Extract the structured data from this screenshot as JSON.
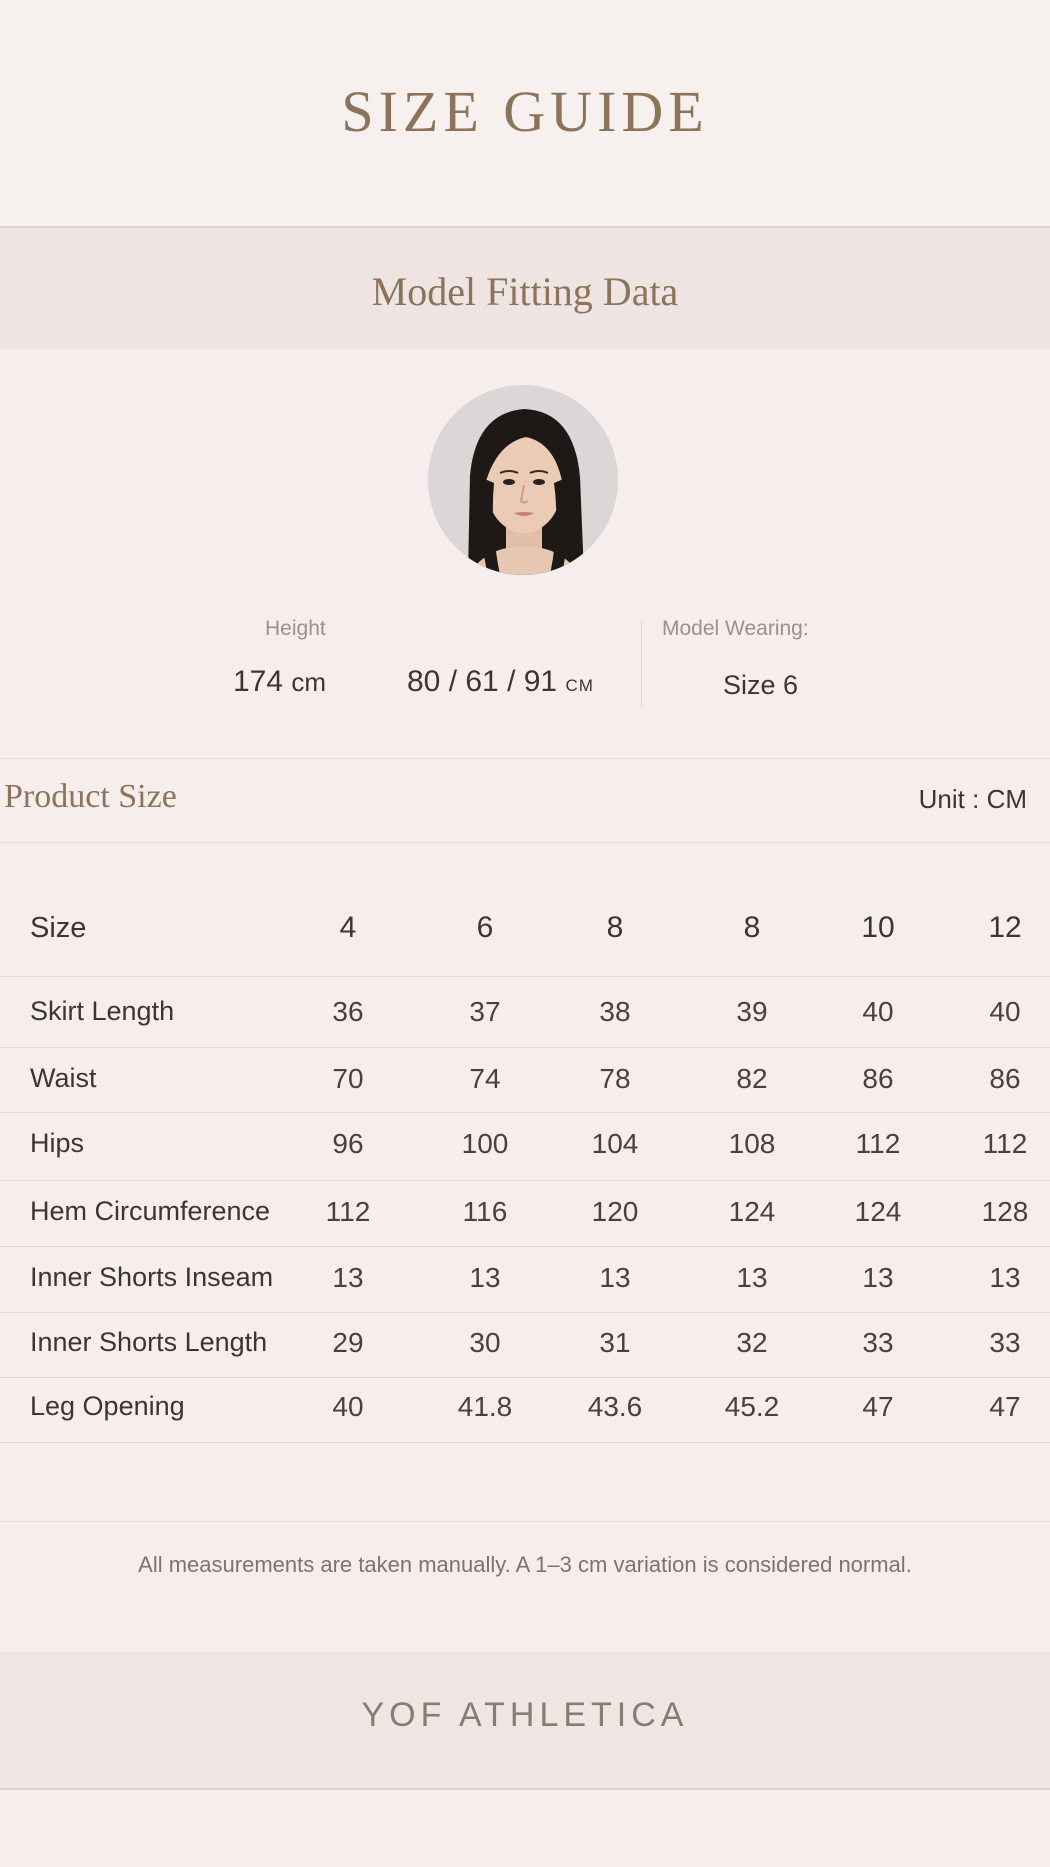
{
  "header": {
    "title": "SIZE GUIDE"
  },
  "model_fitting": {
    "title": "Model Fitting Data",
    "height_label": "Height",
    "height_value": "174",
    "height_unit": "cm",
    "measurements_value": "80 / 61 / 91",
    "measurements_unit": "CM",
    "wearing_label": "Model Wearing:",
    "wearing_value": "Size 6"
  },
  "product_size": {
    "title": "Product Size",
    "unit": "Unit : CM"
  },
  "table": {
    "header_label": "Size",
    "sizes": [
      "4",
      "6",
      "8",
      "8",
      "10",
      "12"
    ],
    "rows": [
      {
        "label": "Skirt Length",
        "values": [
          "36",
          "37",
          "38",
          "39",
          "40",
          "40"
        ]
      },
      {
        "label": "Waist",
        "values": [
          "70",
          "74",
          "78",
          "82",
          "86",
          "86"
        ]
      },
      {
        "label": "Hips",
        "values": [
          "96",
          "100",
          "104",
          "108",
          "112",
          "112"
        ]
      },
      {
        "label": "Hem Circumference",
        "values": [
          "112",
          "116",
          "120",
          "124",
          "124",
          "128"
        ]
      },
      {
        "label": "Inner Shorts Inseam",
        "values": [
          "13",
          "13",
          "13",
          "13",
          "13",
          "13"
        ]
      },
      {
        "label": "Inner Shorts Length",
        "values": [
          "29",
          "30",
          "31",
          "32",
          "33",
          "33"
        ]
      },
      {
        "label": "Leg Opening",
        "values": [
          "40",
          "41.8",
          "43.6",
          "45.2",
          "47",
          "47"
        ]
      }
    ]
  },
  "note": "All measurements are taken manually. A 1–3 cm variation is considered normal.",
  "footer": {
    "brand": "YOF ATHLETICA"
  }
}
